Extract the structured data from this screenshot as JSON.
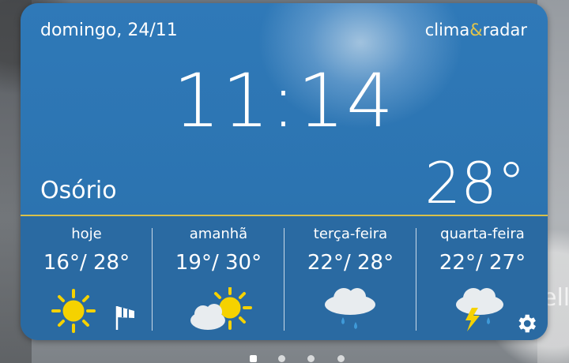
{
  "widget": {
    "date": "domingo, 24/11",
    "brand": {
      "left": "clima",
      "amp": "&",
      "right": "radar"
    },
    "time": "11:14",
    "city": "Osório",
    "current_temp": "28°"
  },
  "forecast": [
    {
      "day": "hoje",
      "range": "16°/ 28°",
      "icon": "sun-icon",
      "extra_icon": "windsock-icon"
    },
    {
      "day": "amanhã",
      "range": "19°/ 30°",
      "icon": "sun-cloud-icon"
    },
    {
      "day": "terça-feira",
      "range": "22°/ 28°",
      "icon": "rain-cloud-icon"
    },
    {
      "day": "quarta-feira",
      "range": "22°/ 27°",
      "icon": "thunderstorm-icon"
    }
  ],
  "background": {
    "side_text": "ello"
  },
  "colors": {
    "widget_blue": "#2f79b8",
    "divider_gold": "#d9c04a",
    "sun_yellow": "#f5d200"
  }
}
